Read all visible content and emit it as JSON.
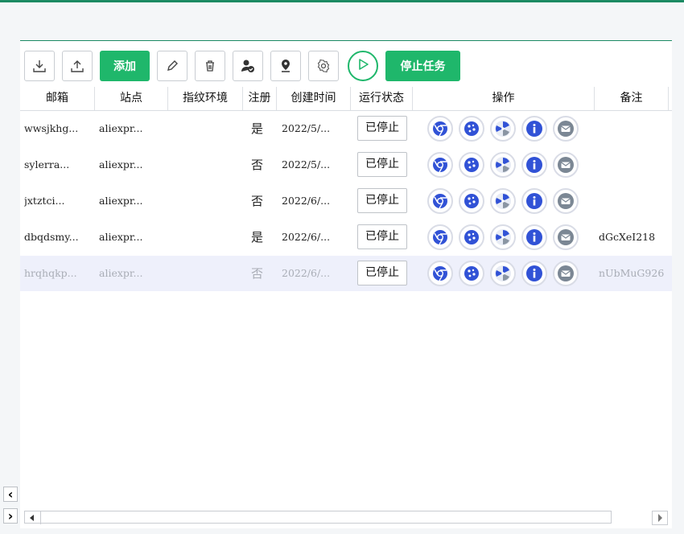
{
  "toolbar": {
    "add_label": "添加",
    "stop_task_label": "停止任务",
    "icons": [
      "download-icon",
      "upload-icon",
      "edit-icon",
      "delete-icon",
      "user-check-icon",
      "location-icon",
      "settings-icon",
      "play-icon"
    ]
  },
  "table": {
    "columns": [
      "邮箱",
      "站点",
      "指纹环境",
      "注册",
      "创建时间",
      "运行状态",
      "操作",
      "备注"
    ],
    "rows": [
      {
        "email": "wwsjkhg...",
        "site": "aliexpr...",
        "fingerprint": "",
        "registered": "是",
        "created": "2022/5/...",
        "status": "已停止",
        "note": ""
      },
      {
        "email": "sylerra...",
        "site": "aliexpr...",
        "fingerprint": "",
        "registered": "否",
        "created": "2022/5/...",
        "status": "已停止",
        "note": ""
      },
      {
        "email": "jxtztci...",
        "site": "aliexpr...",
        "fingerprint": "",
        "registered": "否",
        "created": "2022/6/...",
        "status": "已停止",
        "note": ""
      },
      {
        "email": "dbqdsmy...",
        "site": "aliexpr...",
        "fingerprint": "",
        "registered": "是",
        "created": "2022/6/...",
        "status": "已停止",
        "note": "dGcXeI218"
      },
      {
        "email": "hrqhqkp...",
        "site": "aliexpr...",
        "fingerprint": "",
        "registered": "否",
        "created": "2022/6/...",
        "status": "已停止",
        "note": "nUbMuG926"
      }
    ],
    "row_actions": [
      "chrome-icon",
      "cookie-icon",
      "fan-icon",
      "info-icon",
      "mail-icon"
    ]
  },
  "colors": {
    "accent": "#1fb76b",
    "brand_line": "#1b8a63",
    "action_blue": "#3152d6",
    "action_gray": "#7b8794"
  }
}
